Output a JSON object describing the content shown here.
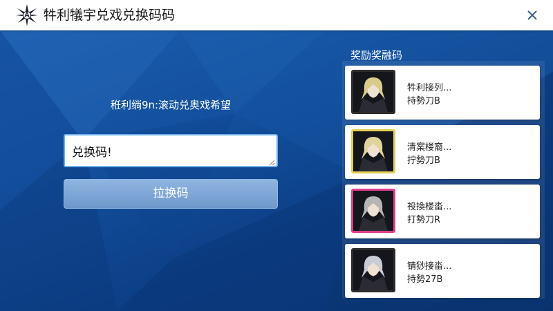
{
  "header": {
    "title": "牪利犠宇兑戏兑换码码"
  },
  "main": {
    "subtitle": "秹利绱9n:滚动兑奥戏希望",
    "code_input_value": "兑换码!",
    "redeem_button_label": "拉换码"
  },
  "rewards": {
    "title": "奖励奖融码",
    "items": [
      {
        "name": "牪利接列...",
        "subtitle": "持勢刀B",
        "border_color": "#2d2d2d",
        "hair_color": "#d8cb8c"
      },
      {
        "name": "清案楼裔...",
        "subtitle": "拧勢刀B",
        "border_color": "#e2cf50",
        "hair_color": "#e0d49a"
      },
      {
        "name": "祋換楼畓...",
        "subtitle": "打勢刀R",
        "border_color": "#de3f8a",
        "hair_color": "#b5b5b5"
      },
      {
        "name": "锖猀接畓...",
        "subtitle": "持勢27B",
        "border_color": "#2d2d2d",
        "hair_color": "#c9ccd4"
      }
    ]
  },
  "colors": {
    "background": "#0d3a78",
    "accent": "#6fb0ec",
    "button": "#7fa6d6"
  },
  "icons": {
    "logo": "star-emblem-icon",
    "close": "close-icon"
  }
}
